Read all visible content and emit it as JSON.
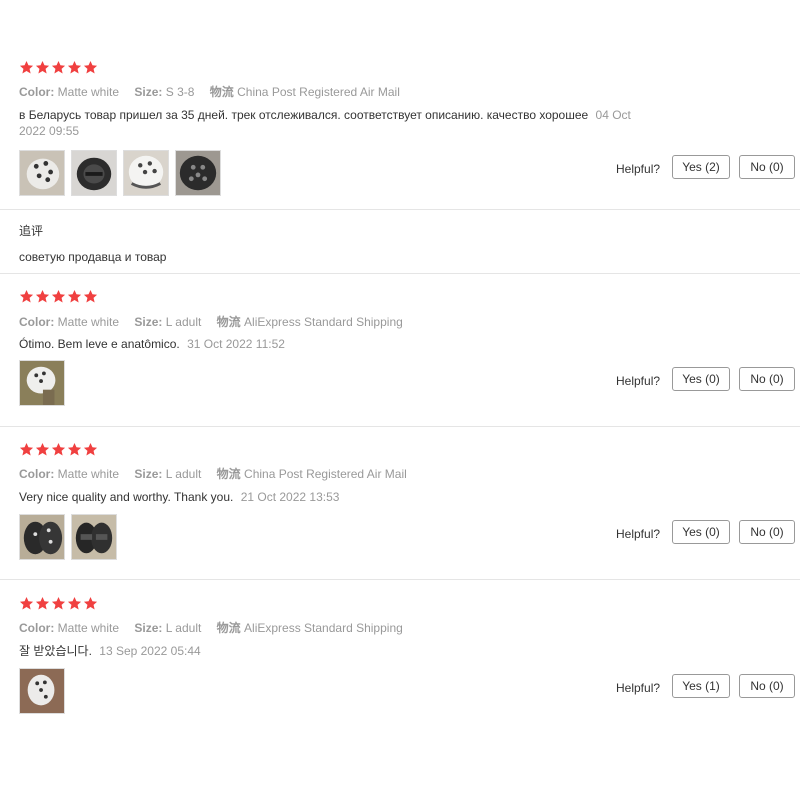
{
  "labels": {
    "color": "Color:",
    "size": "Size:",
    "shipping": "物流",
    "helpful": "Helpful?"
  },
  "colors": {
    "star": "#f04040",
    "muted": "#999999",
    "text": "#333333",
    "border": "#999999"
  },
  "reviews": [
    {
      "rating": 5,
      "color_value": "Matte white",
      "size_value": "S 3-8",
      "shipping_value": "China Post Registered Air Mail",
      "text": "в Беларусь товар пришел за 35 дней. трек отслеживался. соответствует описанию. качество хорошее",
      "date_part1": "04 Oct",
      "date_part2": "2022 09:55",
      "images": [
        "helmet-photo",
        "helmet-photo",
        "helmet-photo",
        "helmet-photo"
      ],
      "yes_label": "Yes (2)",
      "no_label": "No (0)",
      "additional": {
        "heading": "追评",
        "text": "советую продавца и товар"
      }
    },
    {
      "rating": 5,
      "color_value": "Matte white",
      "size_value": "L adult",
      "shipping_value": "AliExpress Standard Shipping",
      "text": "Ótimo. Bem leve e anatômico.",
      "date": "31 Oct 2022 11:52",
      "images": [
        "helmet-photo"
      ],
      "yes_label": "Yes (0)",
      "no_label": "No (0)"
    },
    {
      "rating": 5,
      "color_value": "Matte white",
      "size_value": "L adult",
      "shipping_value": "China Post Registered Air Mail",
      "text": "Very nice quality and worthy. Thank you.",
      "date": "21 Oct 2022 13:53",
      "images": [
        "helmet-photo",
        "helmet-photo"
      ],
      "yes_label": "Yes (0)",
      "no_label": "No (0)"
    },
    {
      "rating": 5,
      "color_value": "Matte white",
      "size_value": "L adult",
      "shipping_value": "AliExpress Standard Shipping",
      "text": "잘 받았습니다.",
      "date": "13 Sep 2022 05:44",
      "images": [
        "helmet-photo"
      ],
      "yes_label": "Yes (1)",
      "no_label": "No (0)"
    }
  ]
}
